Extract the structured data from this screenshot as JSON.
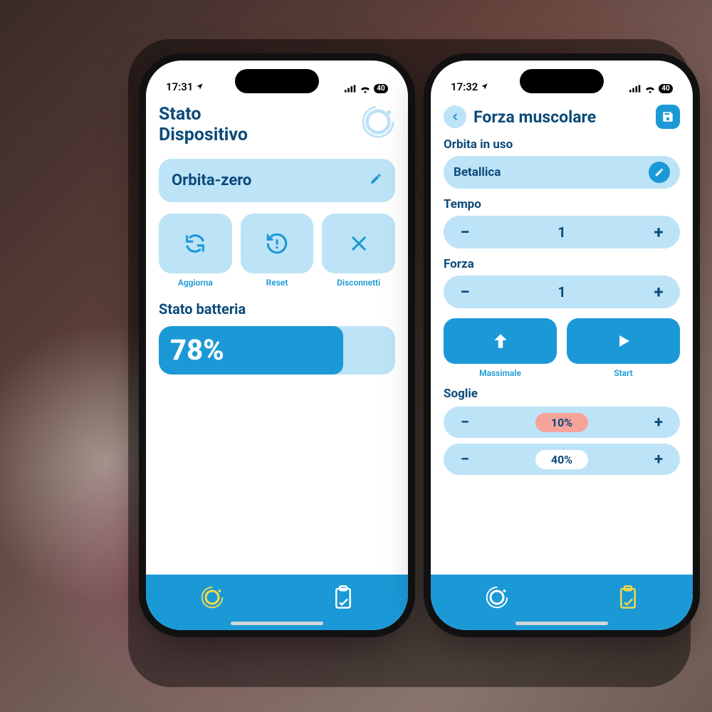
{
  "left": {
    "status": {
      "time": "17:31",
      "battery_badge": "40"
    },
    "title": "Stato\nDispositivo",
    "device_card": {
      "name": "Orbita-zero"
    },
    "actions": {
      "refresh": "Aggiorna",
      "reset": "Reset",
      "disconnect": "Disconnetti"
    },
    "battery_section_label": "Stato batteria",
    "battery_value": "78%",
    "battery_percent": 78
  },
  "right": {
    "status": {
      "time": "17:32",
      "battery_badge": "40"
    },
    "title": "Forza muscolare",
    "orbit_label": "Orbita in uso",
    "orbit_value": "Betallica",
    "tempo_label": "Tempo",
    "tempo_value": "1",
    "forza_label": "Forza",
    "forza_value": "1",
    "maximal_label": "Massimale",
    "start_label": "Start",
    "thresholds_label": "Soglie",
    "threshold1": "10%",
    "threshold2": "40%"
  }
}
